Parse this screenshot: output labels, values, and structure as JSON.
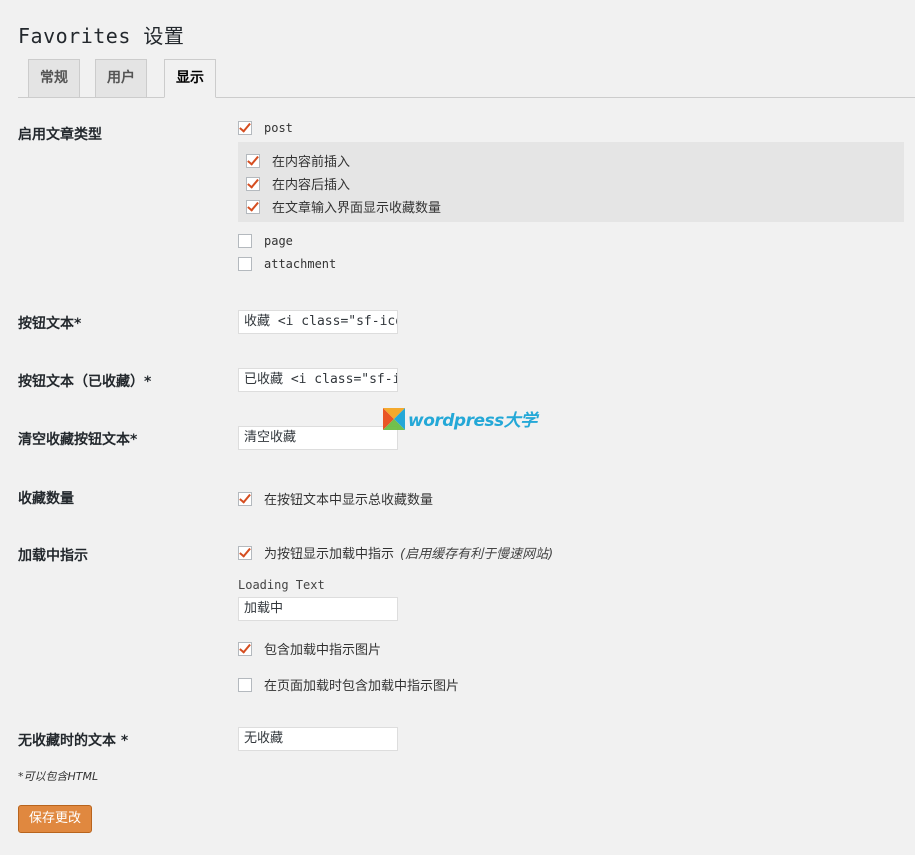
{
  "page": {
    "title": "Favorites 设置"
  },
  "tabs": [
    {
      "label": "常规",
      "active": false
    },
    {
      "label": "用户",
      "active": false
    },
    {
      "label": "显示",
      "active": true
    }
  ],
  "post_types": {
    "label": "启用文章类型",
    "post": {
      "label": "post",
      "checked": true
    },
    "post_options": [
      {
        "label": "在内容前插入",
        "checked": true
      },
      {
        "label": "在内容后插入",
        "checked": true
      },
      {
        "label": "在文章输入界面显示收藏数量",
        "checked": true
      }
    ],
    "page": {
      "label": "page",
      "checked": false
    },
    "attachment": {
      "label": "attachment",
      "checked": false
    }
  },
  "button_text": {
    "label": "按钮文本*",
    "value": "收藏 <i class=\"sf-ico"
  },
  "button_text_favorited": {
    "label": "按钮文本（已收藏）*",
    "value": "已收藏 <i class=\"sf-i"
  },
  "clear_button_text": {
    "label": "清空收藏按钮文本*",
    "value": "清空收藏"
  },
  "favorite_count": {
    "label": "收藏数量",
    "option": {
      "label": "在按钮文本中显示总收藏数量",
      "checked": true
    }
  },
  "loading": {
    "label": "加载中指示",
    "option": {
      "label": "为按钮显示加载中指示",
      "hint": "(启用缓存有利于慢速网站)",
      "checked": true
    },
    "loading_text_label": "Loading Text",
    "loading_text_value": "加载中",
    "include_image": {
      "label": "包含加载中指示图片",
      "checked": true
    },
    "include_image_on_load": {
      "label": "在页面加载时包含加载中指示图片",
      "checked": false
    }
  },
  "no_favorites_text": {
    "label": "无收藏时的文本 *",
    "value": "无收藏"
  },
  "footnote": "*可以包含HTML",
  "save_button": "保存更改",
  "watermark": {
    "text": "wordpress大学"
  },
  "colors": {
    "accent": "#e0883f",
    "check": "#d54e21",
    "watermark": "#1aa5d6"
  }
}
